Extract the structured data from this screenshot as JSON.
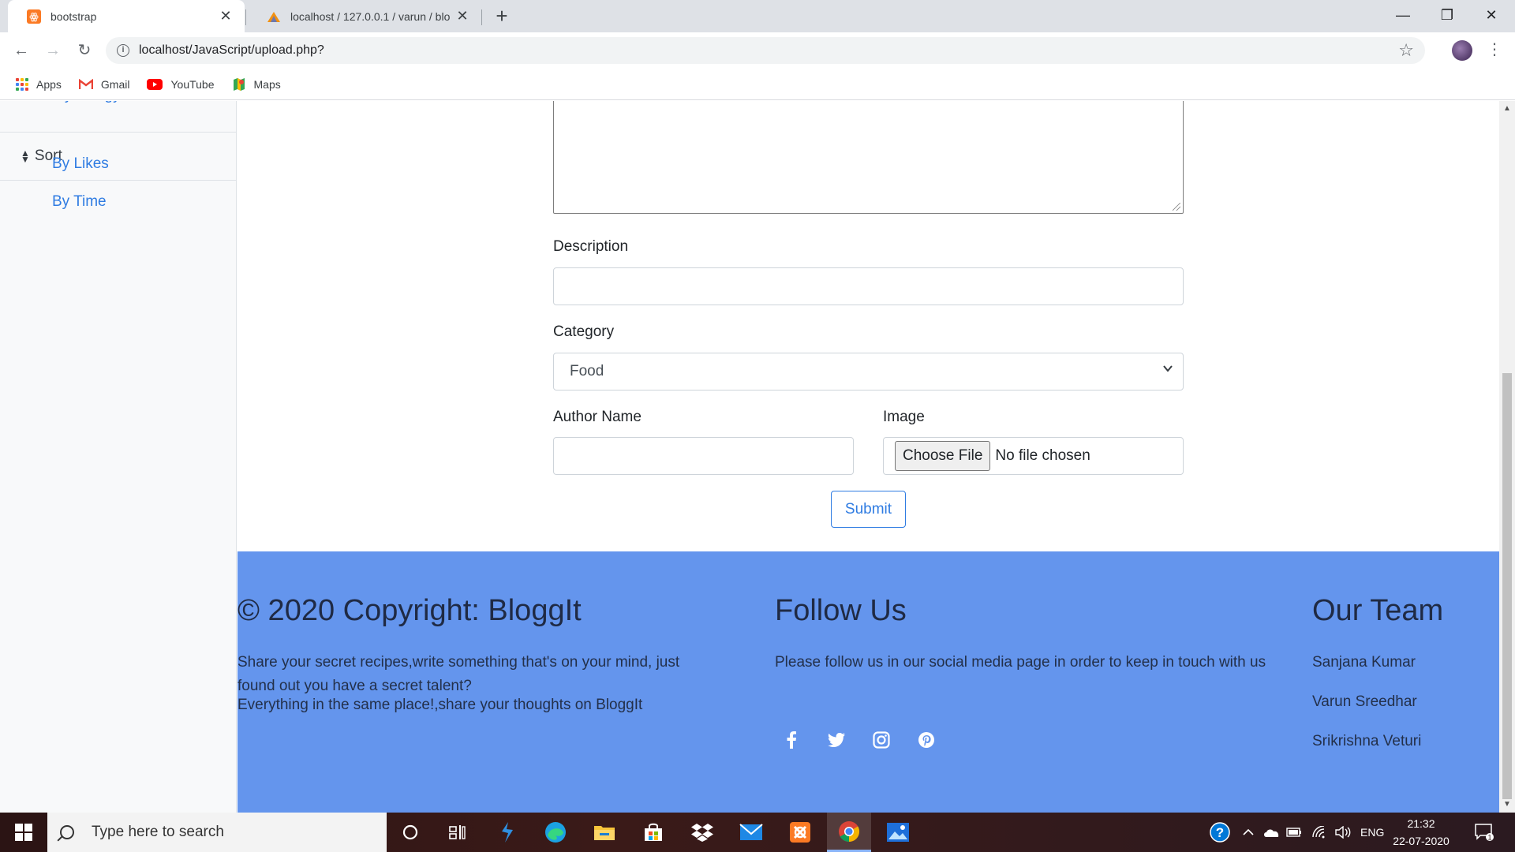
{
  "browser": {
    "tabs": [
      {
        "title": "bootstrap",
        "active": true
      },
      {
        "title": "localhost / 127.0.0.1 / varun / blo",
        "active": false
      }
    ],
    "url": "localhost/JavaScript/upload.php?",
    "bookmarks": [
      "Apps",
      "Gmail",
      "YouTube",
      "Maps"
    ]
  },
  "sidebar": {
    "clipped_item": "mythology",
    "sort_label": "Sort",
    "sort_links": [
      "By Likes",
      "By Time"
    ]
  },
  "form": {
    "description_label": "Description",
    "category_label": "Category",
    "category_value": "Food",
    "author_label": "Author Name",
    "image_label": "Image",
    "choose_file_label": "Choose File",
    "no_file_text": "No file chosen",
    "submit_label": "Submit"
  },
  "footer": {
    "col1": {
      "heading": "© 2020 Copyright: BloggIt",
      "text1": "Share your secret recipes,write something that's on your mind, just found out you have a secret talent?",
      "text2": "Everything in the same place!,share your thoughts on BloggIt"
    },
    "col2": {
      "heading": "Follow Us",
      "text": "Please follow us in our social media page in order to keep in touch with us",
      "icons": [
        "facebook-icon",
        "twitter-icon",
        "instagram-icon",
        "pinterest-icon"
      ]
    },
    "col3": {
      "heading": "Our Team",
      "members": [
        "Sanjana Kumar",
        "Varun Sreedhar",
        "Srikrishna Veturi"
      ]
    },
    "bg_color": "#6495ed"
  },
  "taskbar": {
    "search_placeholder": "Type here to search",
    "language": "ENG",
    "time": "21:32",
    "date": "22-07-2020",
    "notification_count": "1"
  },
  "colors": {
    "link": "#2f7ce2",
    "footer": "#6495ed"
  }
}
